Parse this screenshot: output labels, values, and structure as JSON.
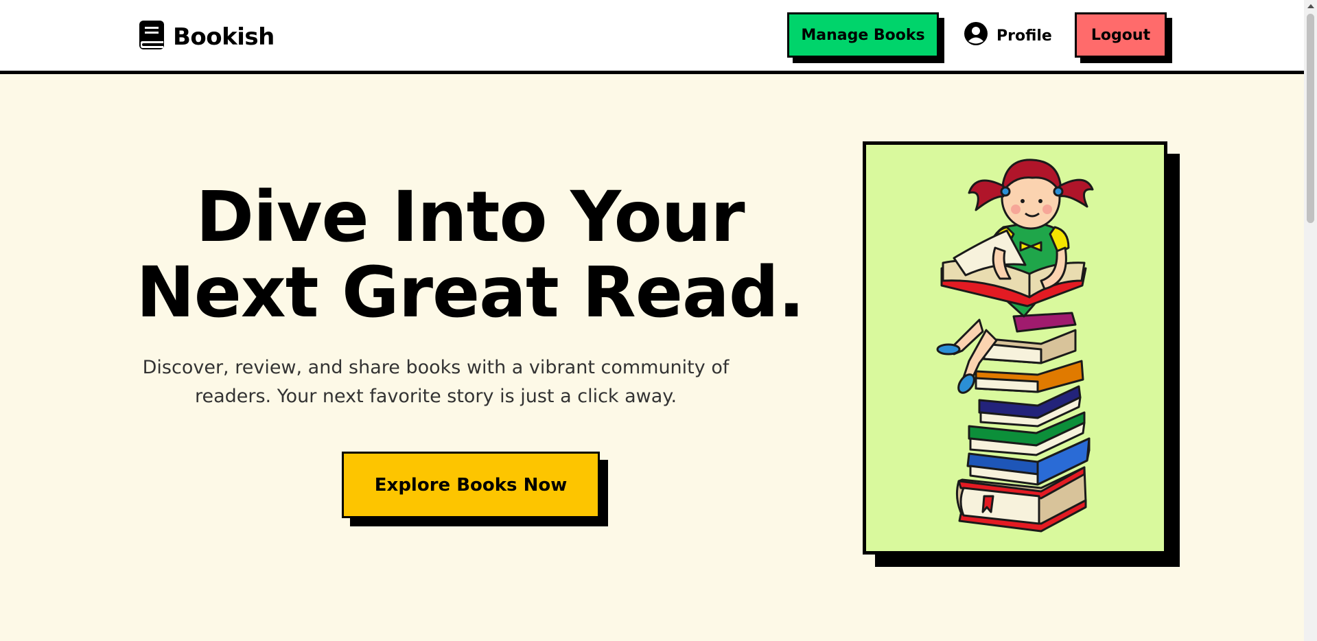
{
  "header": {
    "brand": "Bookish",
    "brand_icon": "book-icon",
    "manage_label": "Manage Books",
    "profile_label": "Profile",
    "profile_icon": "user-circle-icon",
    "logout_label": "Logout"
  },
  "hero": {
    "title_line1": "Dive Into Your",
    "title_line2": "Next Great Read.",
    "subtitle_line1": "Discover, review, and share books with a vibrant community of",
    "subtitle_line2": "readers. Your next favorite story is just a click away.",
    "cta_label": "Explore Books Now"
  },
  "illustration": {
    "description_icon": "girl-reading-on-book-stack-illustration"
  },
  "colors": {
    "page_bg": "#fdf9e7",
    "manage_btn": "#00d46b",
    "logout_btn": "#ff6b6b",
    "cta_btn": "#fdc500",
    "card_bg": "#d9f99d"
  }
}
